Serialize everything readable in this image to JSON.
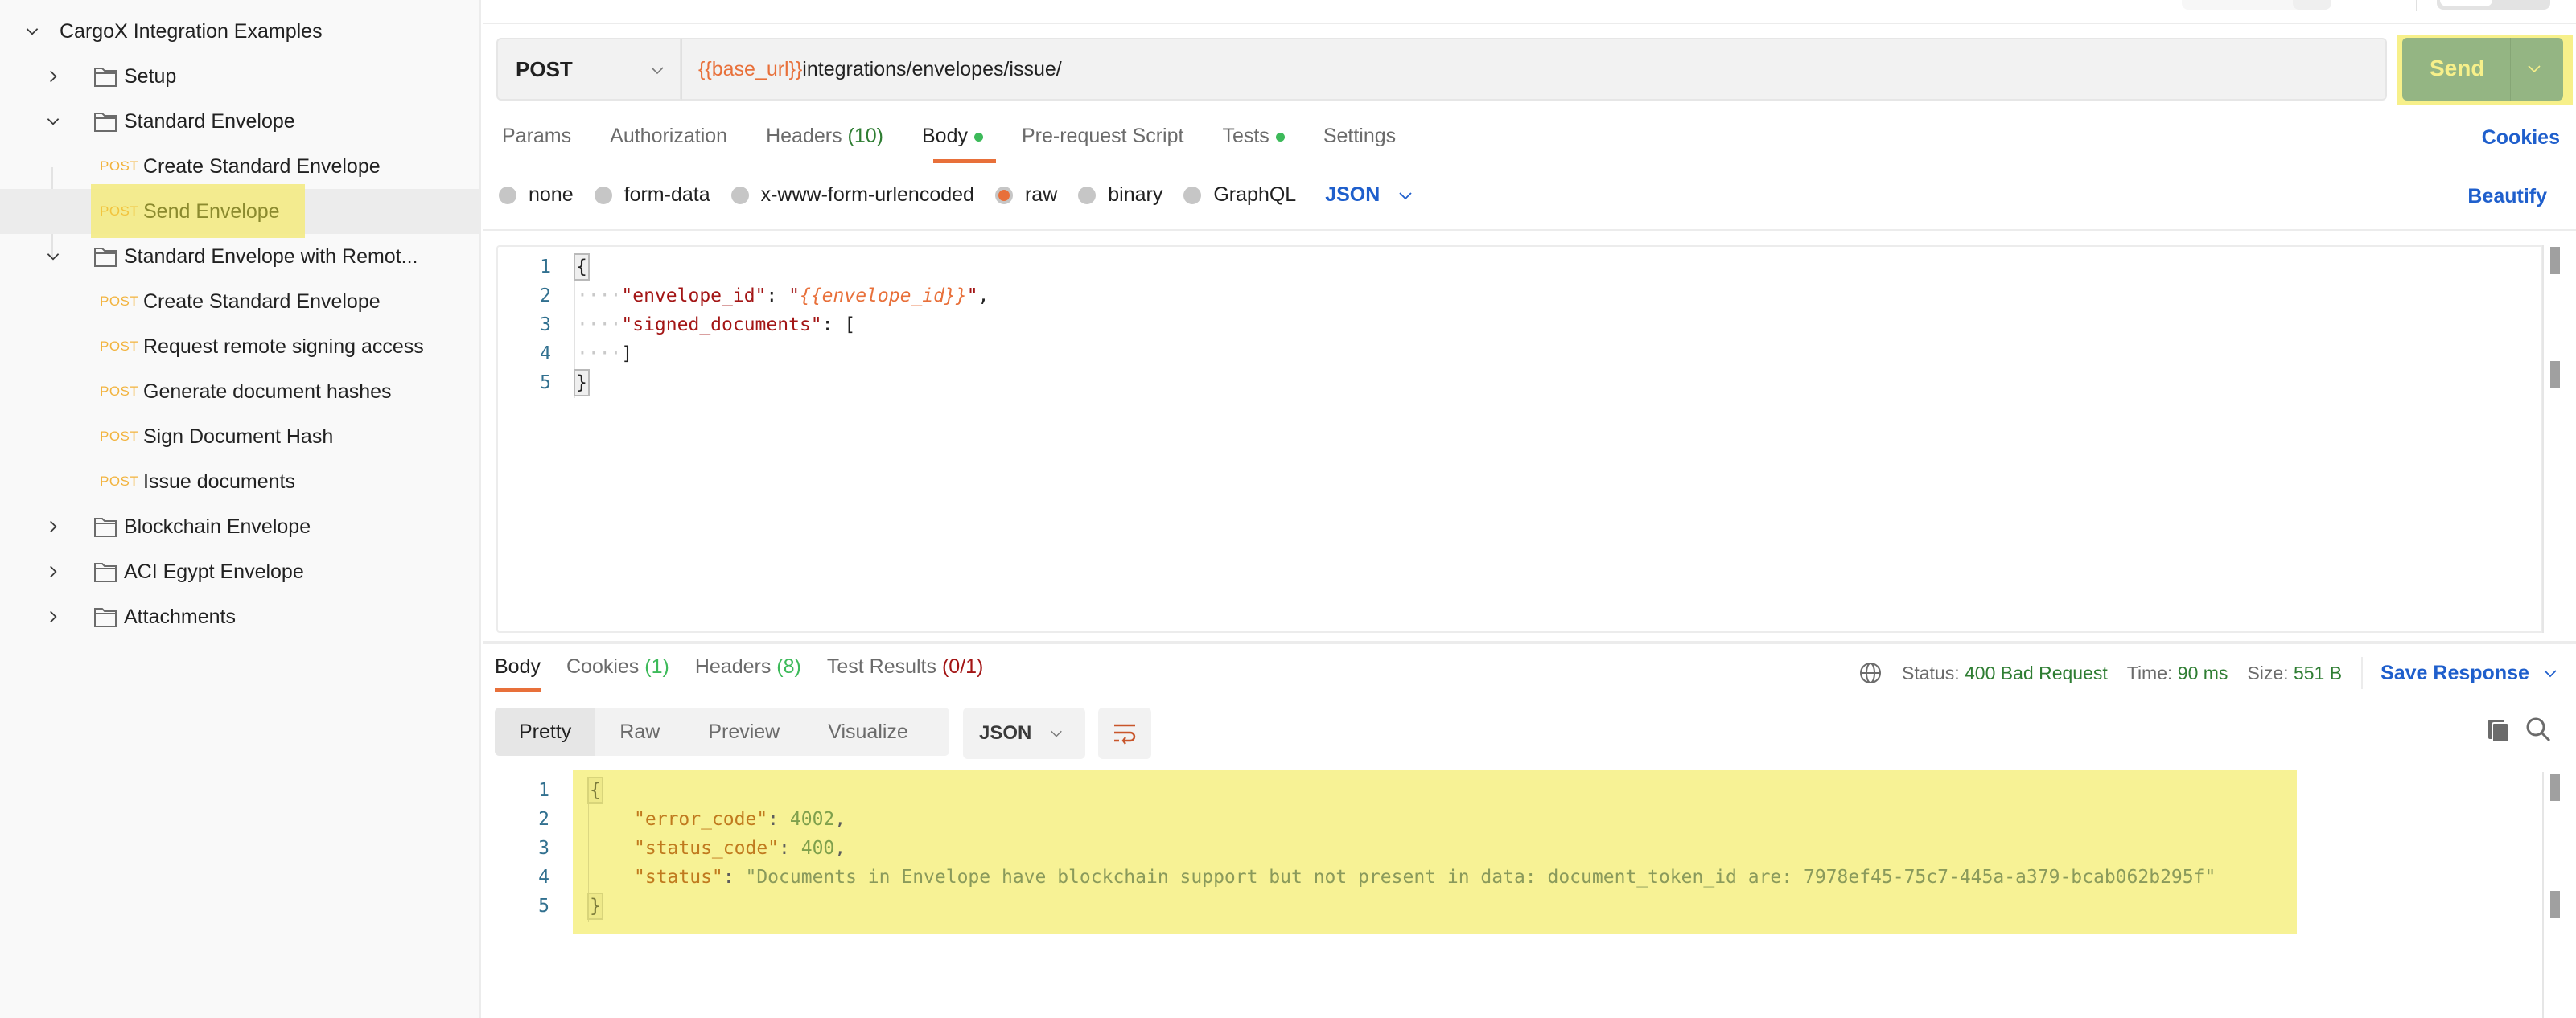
{
  "sidebar": {
    "collection": "CargoX Integration Examples",
    "items": [
      {
        "type": "folder",
        "label": "Setup",
        "expanded": false
      },
      {
        "type": "folder",
        "label": "Standard Envelope",
        "expanded": true
      },
      {
        "type": "request",
        "method": "POST",
        "label": "Create Standard Envelope"
      },
      {
        "type": "request",
        "method": "POST",
        "label": "Send Envelope",
        "selected": true
      },
      {
        "type": "folder",
        "label": "Standard Envelope with Remot...",
        "expanded": true
      },
      {
        "type": "request",
        "method": "POST",
        "label": "Create Standard Envelope"
      },
      {
        "type": "request",
        "method": "POST",
        "label": "Request remote signing access"
      },
      {
        "type": "request",
        "method": "POST",
        "label": "Generate document hashes"
      },
      {
        "type": "request",
        "method": "POST",
        "label": "Sign Document Hash"
      },
      {
        "type": "request",
        "method": "POST",
        "label": "Issue documents"
      },
      {
        "type": "folder",
        "label": "Blockchain Envelope",
        "expanded": false
      },
      {
        "type": "folder",
        "label": "ACI Egypt Envelope",
        "expanded": false
      },
      {
        "type": "folder",
        "label": "Attachments",
        "expanded": false
      }
    ]
  },
  "request": {
    "method": "POST",
    "url_variable": "{{base_url}}",
    "url_path": "integrations/envelopes/issue/",
    "send_label": "Send",
    "tabs": [
      {
        "label": "Params"
      },
      {
        "label": "Authorization"
      },
      {
        "label": "Headers",
        "count": "(10)"
      },
      {
        "label": "Body",
        "dot": true,
        "active": true
      },
      {
        "label": "Pre-request Script"
      },
      {
        "label": "Tests",
        "dot": true
      },
      {
        "label": "Settings"
      }
    ],
    "cookies_link": "Cookies",
    "body_types": [
      "none",
      "form-data",
      "x-www-form-urlencoded",
      "raw",
      "binary",
      "GraphQL"
    ],
    "body_type_selected": "raw",
    "body_format": "JSON",
    "beautify_label": "Beautify",
    "body_lines": [
      {
        "n": "1",
        "text": "{"
      },
      {
        "n": "2",
        "key": "\"envelope_id\"",
        "sep": ": ",
        "q1": "\"",
        "var": "{{envelope_id}}",
        "q2": "\"",
        "tail": ","
      },
      {
        "n": "3",
        "key": "\"signed_documents\"",
        "sep": ": ",
        "tail": "["
      },
      {
        "n": "4",
        "text": "]"
      },
      {
        "n": "5",
        "text": "}"
      }
    ]
  },
  "response": {
    "tabs": [
      {
        "label": "Body",
        "active": true
      },
      {
        "label": "Cookies",
        "count": "(1)"
      },
      {
        "label": "Headers",
        "count": "(8)"
      },
      {
        "label": "Test Results",
        "count": "(0/1)"
      }
    ],
    "status_label": "Status:",
    "status_value": "400 Bad Request",
    "time_label": "Time:",
    "time_value": "90 ms",
    "size_label": "Size:",
    "size_value": "551 B",
    "save_response": "Save Response",
    "views": [
      "Pretty",
      "Raw",
      "Preview",
      "Visualize"
    ],
    "view_selected": "Pretty",
    "format": "JSON",
    "lines": [
      {
        "n": "1",
        "text": "{"
      },
      {
        "n": "2",
        "key": "\"error_code\"",
        "value": "4002",
        "tail": ","
      },
      {
        "n": "3",
        "key": "\"status_code\"",
        "value": "400",
        "tail": ","
      },
      {
        "n": "4",
        "key": "\"status\"",
        "string": "\"Documents in Envelope have blockchain support but not present in data: document_token_id are: 7978ef45-75c7-445a-a379-bcab062b295f\""
      },
      {
        "n": "5",
        "text": "}"
      }
    ]
  },
  "colors": {
    "accent": "#e8703a",
    "link": "#1f5fcc",
    "method_post": "#f2b33d",
    "status_ok": "#2e7d32",
    "send_bg": "#94b583",
    "highlight": "#f7f295"
  }
}
